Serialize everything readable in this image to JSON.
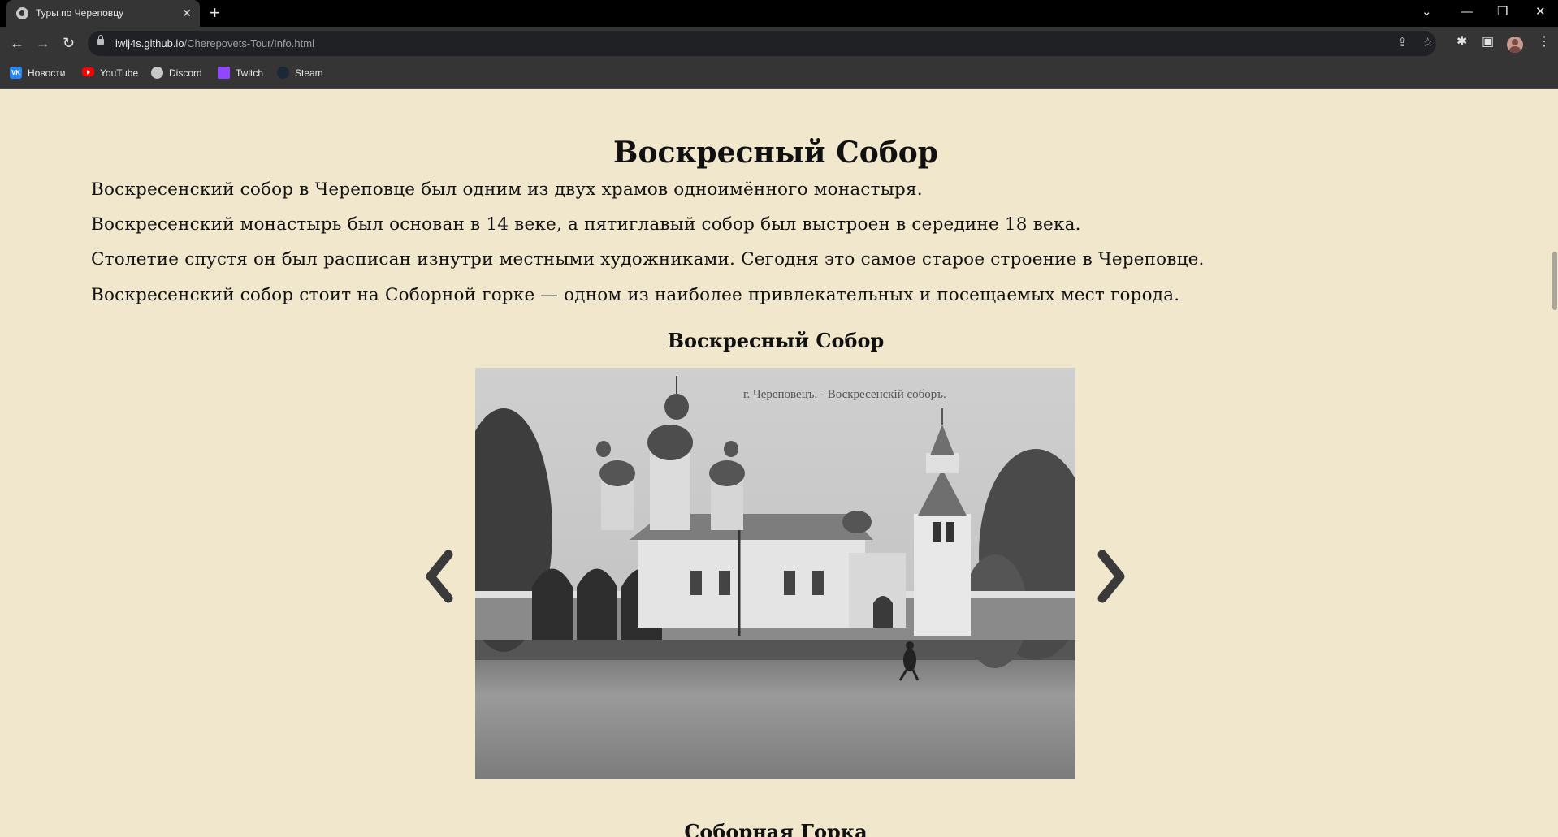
{
  "browser": {
    "tab_title": "Туры по Череповцу",
    "tab_close": "✕",
    "new_tab": "+",
    "url_host": "iwlj4s.github.io",
    "url_path": "/Cherepovets-Tour/Info.html",
    "bookmarks": [
      {
        "label": "Новости",
        "icon": "vk-icon",
        "icon_text": "VK"
      },
      {
        "label": "YouTube",
        "icon": "youtube-icon"
      },
      {
        "label": "Discord",
        "icon": "discord-icon"
      },
      {
        "label": "Twitch",
        "icon": "twitch-icon"
      },
      {
        "label": "Steam",
        "icon": "steam-icon"
      }
    ]
  },
  "page": {
    "title": "Воскресный Собор",
    "paragraphs": [
      "Воскресенский собор в Череповце был одним из двух храмов одноимённого монастыря.",
      "Воскресенский монастырь был основан в 14 веке, а пятиглавый собор был выстроен в середине 18 века.",
      "Столетие спустя он был расписан изнутри местными художниками. Сегодня это самое старое строение в Череповце.",
      "Воскресенский собор стоит на Соборной горке — одном из наиболее привлекательных и посещаемых мест города."
    ],
    "gallery": {
      "caption": "Воскресный Собор",
      "photo_inscription": "г. Череповецъ. - Воскресенскій соборъ.",
      "prev_icon": "chevron-left-icon",
      "next_icon": "chevron-right-icon"
    },
    "next_caption": "Соборная Горка"
  },
  "colors": {
    "page_background": "#f1e7cd",
    "text": "#111111",
    "arrow": "#3a3a3a",
    "chrome_dark": "#353535"
  }
}
